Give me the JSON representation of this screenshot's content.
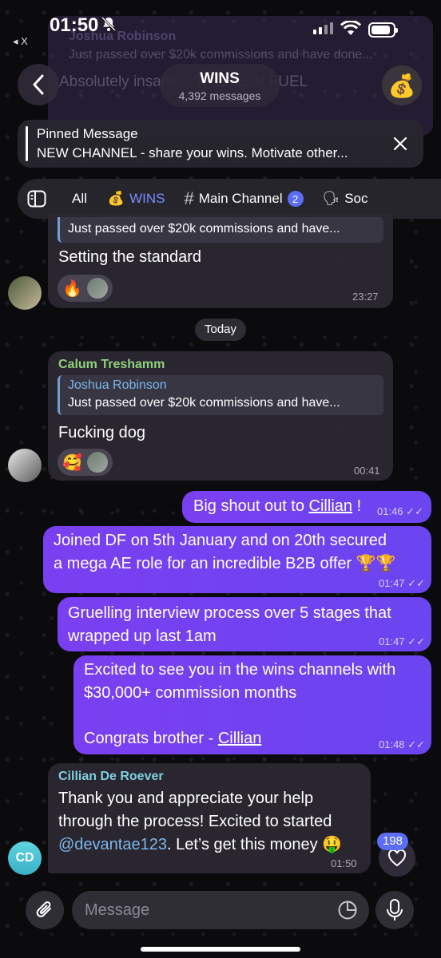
{
  "status_bar": {
    "time": "01:50",
    "back_app": "◂ X"
  },
  "background_message": {
    "reply_name": "Joshua Robinson",
    "reply_text": "Just passed over $20k commissions and have done...",
    "text": "Absolutely insane... THE DEALFUEL"
  },
  "header": {
    "title": "WINS",
    "subtitle": "4,392 messages",
    "avatar_emoji": "💰"
  },
  "pinned": {
    "title": "Pinned Message",
    "text": "NEW CHANNEL - share your wins. Motivate other..."
  },
  "tabs": [
    {
      "label": "All",
      "icon": ""
    },
    {
      "label": "WINS",
      "icon": "💰",
      "active": true
    },
    {
      "label": "Main Channel",
      "icon": "#",
      "badge": "2"
    },
    {
      "label": "Soc",
      "icon": "🗣"
    }
  ],
  "messages": {
    "m1": {
      "reply_text": "Just passed over $20k commissions and have...",
      "text": "Setting the standard",
      "reaction_emoji": "🔥",
      "time": "23:27"
    },
    "date_separator": "Today",
    "m2": {
      "sender": "Calum Treshamm",
      "reply_name": "Joshua Robinson",
      "reply_text": "Just passed over $20k commissions and have...",
      "text": "Fucking dog",
      "reaction_emoji": "🥰",
      "time": "00:41"
    },
    "m3": {
      "text_before": "Big shout out to ",
      "link": "Cillian",
      "text_after": " !",
      "time": "01:46"
    },
    "m4": {
      "line1": "Joined DF on 5th January and on 20th secured",
      "line2": "a mega AE role for an incredible B2B offer 🏆🏆",
      "time": "01:47"
    },
    "m5": {
      "line1": "Gruelling interview process over 5 stages that",
      "line2": "wrapped up last 1am",
      "time": "01:47"
    },
    "m6": {
      "line1": "Excited to see you in the wins channels with",
      "line2": "$30,000+ commission months",
      "line3_before": "Congrats brother - ",
      "line3_link": "Cillian",
      "time": "01:48"
    },
    "m7": {
      "sender": "Cillian De Roever",
      "line1": "Thank you and appreciate your help",
      "line2": "through the process! Excited to started",
      "mention": "@devantae123",
      "line3_after": ". Let’s get this money 🤑",
      "time": "01:50",
      "avatar_initials": "CD"
    }
  },
  "scroll": {
    "unread_count": "198"
  },
  "input": {
    "placeholder": "Message"
  },
  "colors": {
    "accent": "#7b8cff",
    "outgoing": "#6f42f0",
    "incoming": "#2c2832",
    "sender_green": "#8fd27c",
    "sender_cyan": "#7fd0e0"
  }
}
